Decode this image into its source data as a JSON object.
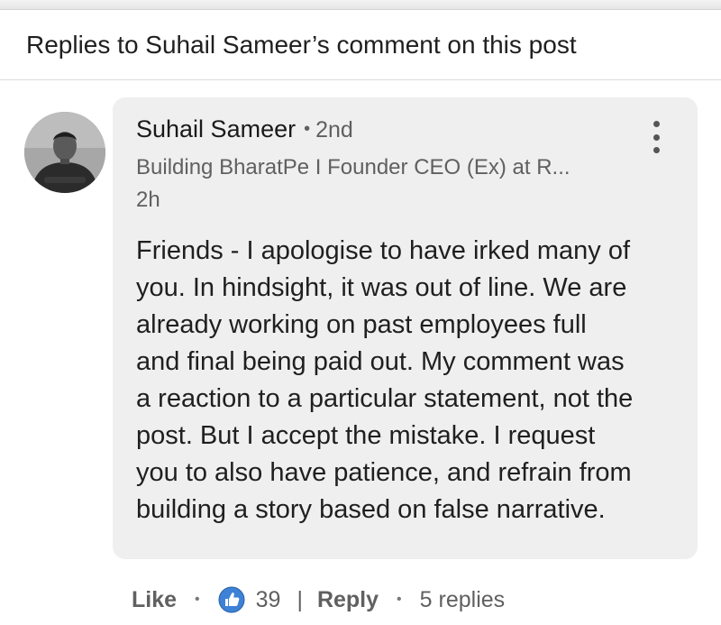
{
  "header": {
    "title": "Replies to Suhail Sameer’s comment on this post"
  },
  "comment": {
    "author": "Suhail Sameer",
    "separator": "•",
    "degree": "2nd",
    "headline": "Building BharatPe I Founder CEO (Ex) at R...",
    "time": "2h",
    "body_lines": [
      "Friends - I apologise to have irked many of",
      "you. In hindsight, it was out of line. We are",
      "already working on past employees full",
      "and final being paid out. My comment was",
      "a reaction to a particular statement, not the",
      "post. But I accept the mistake. I request",
      "you to also have patience, and refrain from",
      "building a story based on false narrative."
    ],
    "more_icon": "vertical-ellipsis-icon",
    "avatar_icon": "profile-photo"
  },
  "actions": {
    "like_label": "Like",
    "dot": "•",
    "like_icon": "thumbs-up-icon",
    "like_count": "39",
    "bar": "|",
    "reply_label": "Reply",
    "replies_count": "5 replies"
  },
  "colors": {
    "bubble_bg": "#efefef",
    "like_icon_blue": "#3d82d6",
    "secondary_text": "#606060",
    "primary_text": "#1f1f1f"
  }
}
